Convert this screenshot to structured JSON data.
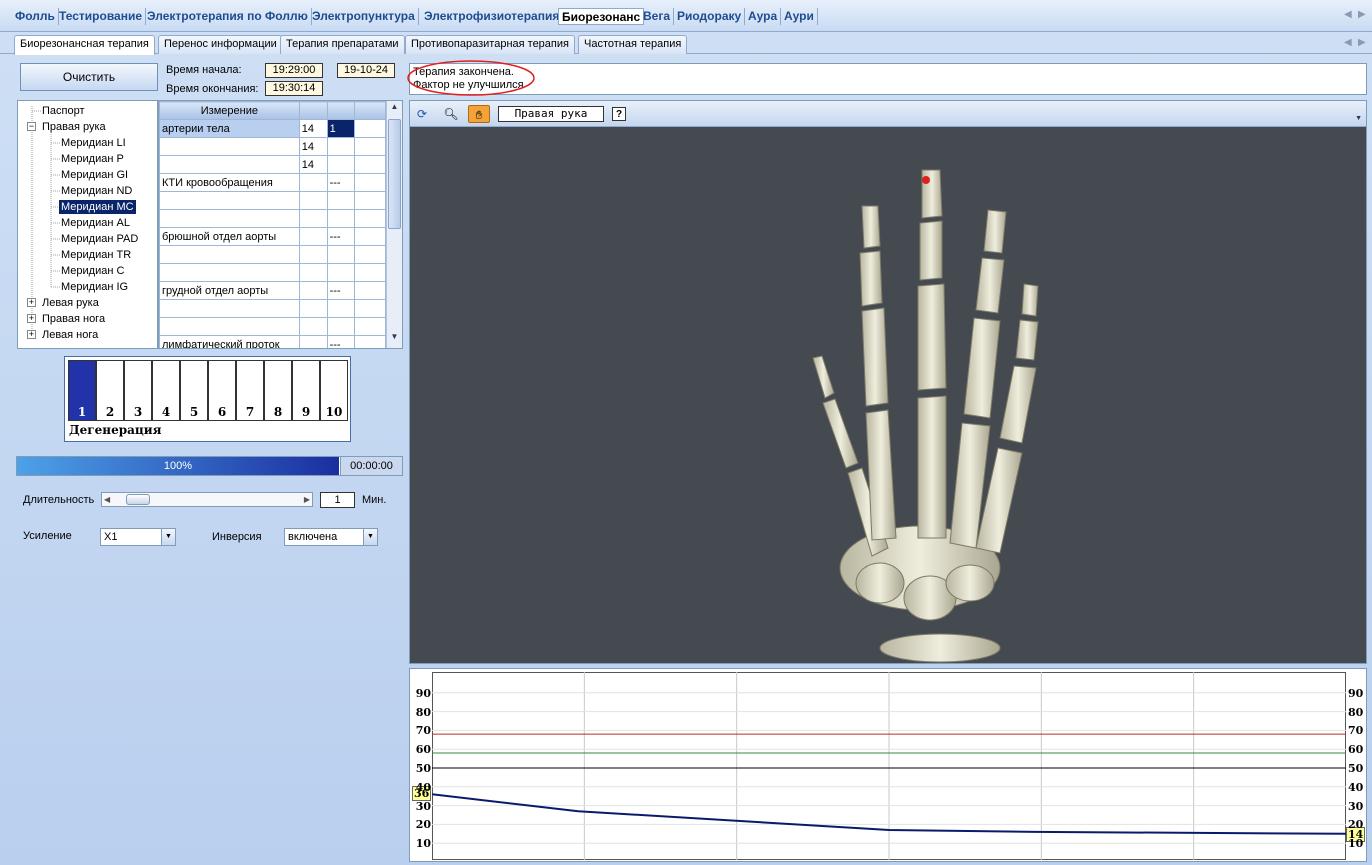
{
  "top_tabs": [
    "Фолль",
    "Тестирование",
    "Электротерапия по Фоллю",
    "Электропунктура",
    "Электрофизиотерапия",
    "Биорезонанс",
    "Вега",
    "Риодораку",
    "Аура",
    "Аури"
  ],
  "sub_tabs": [
    "Биорезонансная терапия",
    "Перенос информации",
    "Терапия препаратами",
    "Противопаразитарная терапия",
    "Частотная терапия"
  ],
  "controls": {
    "clear_button": "Очистить",
    "start_label": "Время начала:",
    "start_time": "19:29:00",
    "start_date": "19-10-24",
    "end_label": "Время окончания:",
    "end_time": "19:30:14"
  },
  "message": {
    "line1": "Терапия закончена.",
    "line2": "Фактор не улучшился"
  },
  "tree": [
    {
      "label": "Паспорт"
    },
    {
      "label": "Правая рука"
    },
    {
      "label": "Меридиан LI"
    },
    {
      "label": "Меридиан P"
    },
    {
      "label": "Меридиан GI"
    },
    {
      "label": "Меридиан ND"
    },
    {
      "label": "Меридиан MC"
    },
    {
      "label": "Меридиан AL"
    },
    {
      "label": "Меридиан PAD"
    },
    {
      "label": "Меридиан TR"
    },
    {
      "label": "Меридиан C"
    },
    {
      "label": "Меридиан IG"
    },
    {
      "label": "Левая рука"
    },
    {
      "label": "Правая нога"
    },
    {
      "label": "Левая нога"
    }
  ],
  "tree_selected": "Меридиан MC",
  "grid": {
    "header": "Измерение",
    "rows": [
      [
        "артерии тела",
        "14",
        "1"
      ],
      [
        "",
        "14",
        ""
      ],
      [
        "",
        "14",
        ""
      ],
      [
        "КТИ кровообращения",
        "",
        "---"
      ],
      [
        "",
        "",
        ""
      ],
      [
        "",
        "",
        ""
      ],
      [
        "брюшной отдел аорты",
        "",
        "---"
      ],
      [
        "",
        "",
        ""
      ],
      [
        "",
        "",
        ""
      ],
      [
        "грудной отдел аорты",
        "",
        "---"
      ],
      [
        "",
        "",
        ""
      ],
      [
        "",
        "",
        ""
      ],
      [
        "лимфатический проток",
        "",
        "---"
      ]
    ]
  },
  "levels": {
    "values": [
      "1",
      "2",
      "3",
      "4",
      "5",
      "6",
      "7",
      "8",
      "9",
      "10"
    ],
    "active": "1",
    "label": "Дегенерация"
  },
  "progress": {
    "percent_text": "100%",
    "fraction": 1.0,
    "time": "00:00:00"
  },
  "duration": {
    "label": "Длительность",
    "value": "1",
    "unit": "Мин."
  },
  "gain": {
    "label": "Усиление",
    "value": "X1"
  },
  "inversion": {
    "label": "Инверсия",
    "value": "включена"
  },
  "viewer": {
    "selector": "Правая рука"
  },
  "chart_data": {
    "type": "line",
    "ylim": [
      0,
      100
    ],
    "yticks": [
      10,
      20,
      30,
      40,
      50,
      60,
      70,
      80,
      90
    ],
    "reference_lines": [
      {
        "value": 68,
        "color": "#b03020"
      },
      {
        "value": 58,
        "color": "#2e8b3a"
      },
      {
        "value": 50,
        "color": "#000000"
      }
    ],
    "series": [
      {
        "color": "#0a1a6a",
        "x": [
          0,
          0.16,
          0.5,
          0.66,
          1.0
        ],
        "y": [
          36,
          27,
          17,
          16,
          15
        ]
      }
    ],
    "start_label": "36",
    "end_label": "14"
  }
}
